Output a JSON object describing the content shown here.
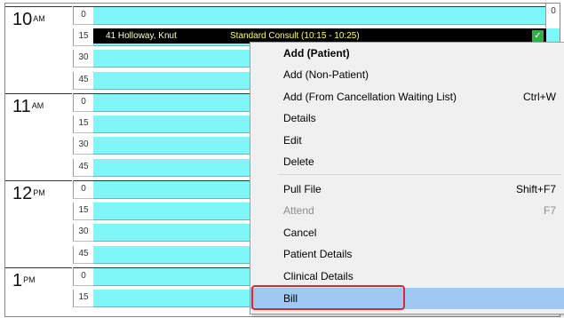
{
  "schedule": {
    "hours": [
      {
        "label": "10",
        "suffix": "AM"
      },
      {
        "label": "11",
        "suffix": "AM"
      },
      {
        "label": "12",
        "suffix": "PM"
      },
      {
        "label": "1",
        "suffix": "PM"
      }
    ],
    "minutes": [
      "0",
      "15",
      "30",
      "45"
    ],
    "right_minute": "0",
    "colors": {
      "slot_bg": "#7ff6f7",
      "appointment_bg": "#000000"
    }
  },
  "appointment": {
    "patient": "41 Holloway, Knut",
    "type": "Standard Consult (10:15 - 10:25)",
    "status_icon": "check-icon",
    "status_glyph": "✓"
  },
  "context_menu": {
    "items": [
      {
        "label": "Add (Patient)",
        "shortcut": "",
        "bold": true,
        "disabled": false
      },
      {
        "label": "Add (Non-Patient)",
        "shortcut": "",
        "bold": false,
        "disabled": false
      },
      {
        "label": "Add (From Cancellation Waiting List)",
        "shortcut": "Ctrl+W",
        "bold": false,
        "disabled": false
      },
      {
        "label": "Details",
        "shortcut": "",
        "bold": false,
        "disabled": false
      },
      {
        "label": "Edit",
        "shortcut": "",
        "bold": false,
        "disabled": false
      },
      {
        "label": "Delete",
        "shortcut": "",
        "bold": false,
        "disabled": false
      },
      {
        "label": "Pull File",
        "shortcut": "Shift+F7",
        "bold": false,
        "disabled": false
      },
      {
        "label": "Attend",
        "shortcut": "F7",
        "bold": false,
        "disabled": true
      },
      {
        "label": "Cancel",
        "shortcut": "",
        "bold": false,
        "disabled": false
      },
      {
        "label": "Patient Details",
        "shortcut": "",
        "bold": false,
        "disabled": false
      },
      {
        "label": "Clinical Details",
        "shortcut": "",
        "bold": false,
        "disabled": false
      },
      {
        "label": "Bill",
        "shortcut": "",
        "bold": false,
        "disabled": false,
        "highlighted": true
      }
    ],
    "highlight_color": "#9ec9f2",
    "annotation_color": "#e0262f"
  }
}
